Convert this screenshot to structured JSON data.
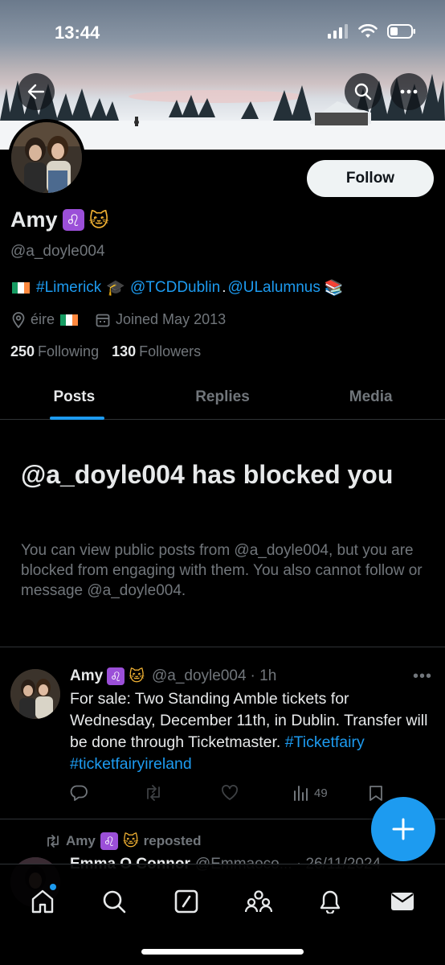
{
  "status": {
    "time": "13:44"
  },
  "header": {
    "back_icon": "arrow-left-icon",
    "search_icon": "search-icon",
    "more_icon": "more-horizontal-icon"
  },
  "profile": {
    "follow_label": "Follow",
    "display_name": "Amy",
    "emoji_leo": "♌",
    "emoji_cat": "🐱",
    "handle": "@a_doyle004",
    "bio": {
      "flag": "ireland-flag",
      "hashtag": "#Limerick",
      "cap": "🎓",
      "mention1": "@TCDDublin",
      "dot": ".",
      "mention2": "@ULalumnus",
      "books": "📚"
    },
    "location": "éire",
    "joined": "Joined May 2013",
    "following_count": "250",
    "following_label": "Following",
    "followers_count": "130",
    "followers_label": "Followers"
  },
  "tabs": [
    {
      "label": "Posts",
      "active": true
    },
    {
      "label": "Replies",
      "active": false
    },
    {
      "label": "Media",
      "active": false
    }
  ],
  "blocked": {
    "title": "@a_doyle004 has blocked you",
    "description": "You can view public posts from @a_doyle004, but you are blocked from engaging with them. You also cannot follow or message @a_doyle004."
  },
  "post": {
    "author": "Amy",
    "handle": "@a_doyle004",
    "time": "· 1h",
    "text": "For sale: Two Standing Amble tickets for Wednesday, December 11th, in Dublin. Transfer will be done through Ticketmaster.",
    "tag1": "#Ticketfairy",
    "tag2": "#ticketfairyireland",
    "views": "49"
  },
  "repost": {
    "reposter": "Amy",
    "repost_label": "reposted",
    "author": "Emma O Connor",
    "handle_time": "@Emmaoco... · 26/11/2024"
  },
  "nav": [
    "home-icon",
    "search-icon",
    "grok-icon",
    "communities-icon",
    "notifications-icon",
    "messages-icon"
  ],
  "colors": {
    "accent": "#1d9bf0",
    "muted": "#71767b",
    "text": "#e7e9ea",
    "background": "#000000"
  }
}
